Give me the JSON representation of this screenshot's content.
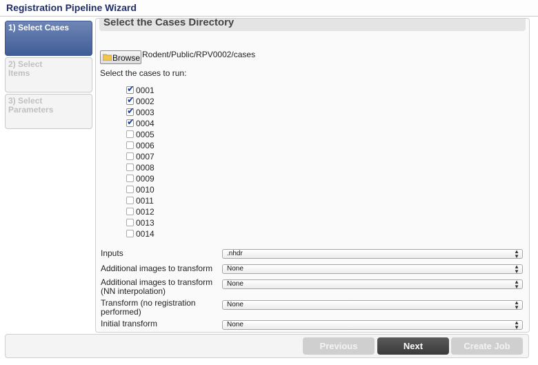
{
  "window": {
    "title": "Registration Pipeline Wizard"
  },
  "steps": [
    {
      "label": "1) Select Cases",
      "active": true
    },
    {
      "label": "2) Select Items",
      "active": false
    },
    {
      "label": "3) Select Parameters",
      "active": false
    }
  ],
  "panel": {
    "title": "Select the Cases Directory",
    "browse_label": "Browse",
    "path": "Rodent/Public/RPV0002/cases",
    "prompt": "Select the cases to run:"
  },
  "cases": [
    {
      "label": "0001",
      "checked": true
    },
    {
      "label": "0002",
      "checked": true
    },
    {
      "label": "0003",
      "checked": true
    },
    {
      "label": "0004",
      "checked": true
    },
    {
      "label": "0005",
      "checked": false
    },
    {
      "label": "0006",
      "checked": false
    },
    {
      "label": "0007",
      "checked": false
    },
    {
      "label": "0008",
      "checked": false
    },
    {
      "label": "0009",
      "checked": false
    },
    {
      "label": "0010",
      "checked": false
    },
    {
      "label": "0011",
      "checked": false
    },
    {
      "label": "0012",
      "checked": false
    },
    {
      "label": "0013",
      "checked": false
    },
    {
      "label": "0014",
      "checked": false
    }
  ],
  "fields": [
    {
      "label": "Inputs",
      "value": ".nhdr"
    },
    {
      "label": "Additional images to transform",
      "value": "None"
    },
    {
      "label": "Additional images to transform (NN interpolation)",
      "value": "None"
    },
    {
      "label": "Transform (no registration performed)",
      "value": "None"
    },
    {
      "label": "Initial transform",
      "value": "None"
    }
  ],
  "buttons": {
    "previous": "Previous",
    "next": "Next",
    "create_job": "Create Job"
  }
}
